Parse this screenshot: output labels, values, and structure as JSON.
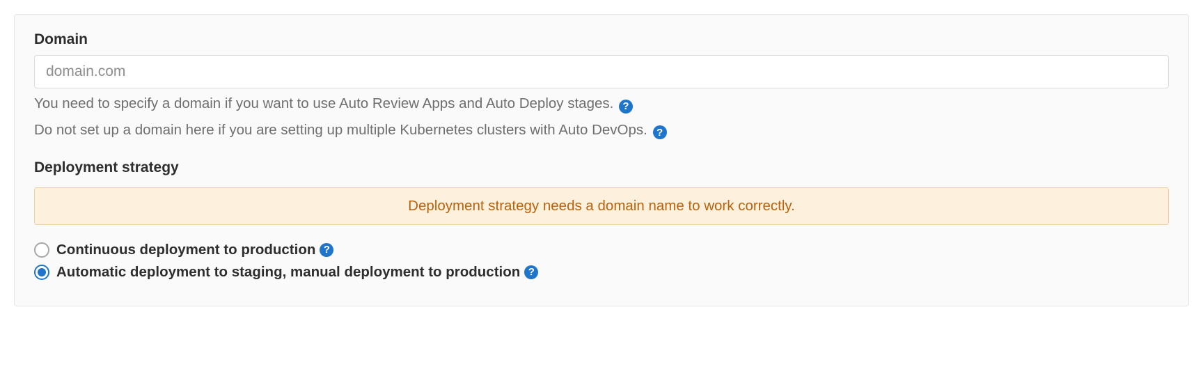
{
  "domain": {
    "label": "Domain",
    "value": "",
    "placeholder": "domain.com",
    "help1": "You need to specify a domain if you want to use Auto Review Apps and Auto Deploy stages.",
    "help2": "Do not set up a domain here if you are setting up multiple Kubernetes clusters with Auto DevOps."
  },
  "strategy": {
    "label": "Deployment strategy",
    "warning": "Deployment strategy needs a domain name to work correctly.",
    "options": {
      "opt1": "Continuous deployment to production",
      "opt2": "Automatic deployment to staging, manual deployment to production"
    },
    "selected": "opt2"
  },
  "icon": {
    "help_glyph": "?"
  }
}
